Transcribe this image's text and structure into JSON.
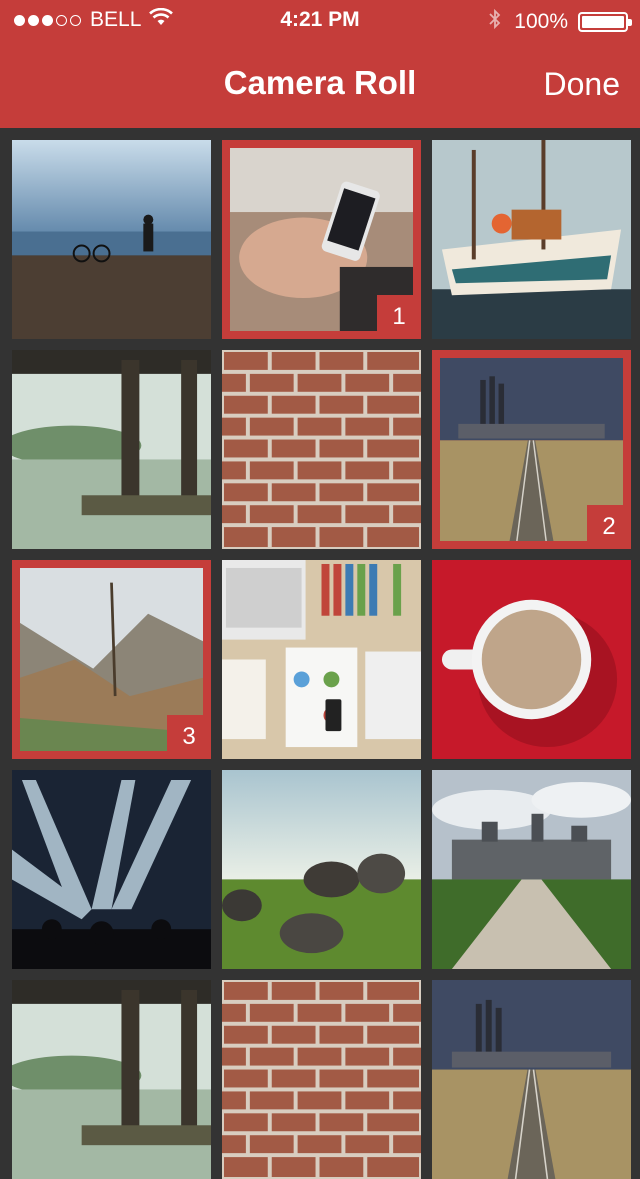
{
  "status_bar": {
    "carrier": "BELL",
    "time": "4:21 PM",
    "battery": "100%",
    "signal_dots_filled": 3,
    "signal_dots_total": 5
  },
  "nav": {
    "title": "Camera Roll",
    "done_label": "Done"
  },
  "colors": {
    "accent": "#c53d3a",
    "background": "#333333"
  },
  "photos": [
    {
      "subject": "lakeside-bicycle",
      "selected": false,
      "order": ""
    },
    {
      "subject": "phone-in-hands",
      "selected": true,
      "order": "1"
    },
    {
      "subject": "sailing-ships",
      "selected": false,
      "order": ""
    },
    {
      "subject": "dock-misty-lake",
      "selected": false,
      "order": ""
    },
    {
      "subject": "brick-wall",
      "selected": false,
      "order": ""
    },
    {
      "subject": "railway-night",
      "selected": true,
      "order": "2"
    },
    {
      "subject": "misty-forest",
      "selected": true,
      "order": "3"
    },
    {
      "subject": "desk-laptop",
      "selected": false,
      "order": ""
    },
    {
      "subject": "coffee-cup",
      "selected": false,
      "order": ""
    },
    {
      "subject": "concert-lights",
      "selected": false,
      "order": ""
    },
    {
      "subject": "field-boulders",
      "selected": false,
      "order": ""
    },
    {
      "subject": "chateau-road",
      "selected": false,
      "order": ""
    },
    {
      "subject": "dock-misty-lake",
      "selected": false,
      "order": ""
    },
    {
      "subject": "brick-wall",
      "selected": false,
      "order": ""
    },
    {
      "subject": "railway-night",
      "selected": false,
      "order": ""
    }
  ]
}
